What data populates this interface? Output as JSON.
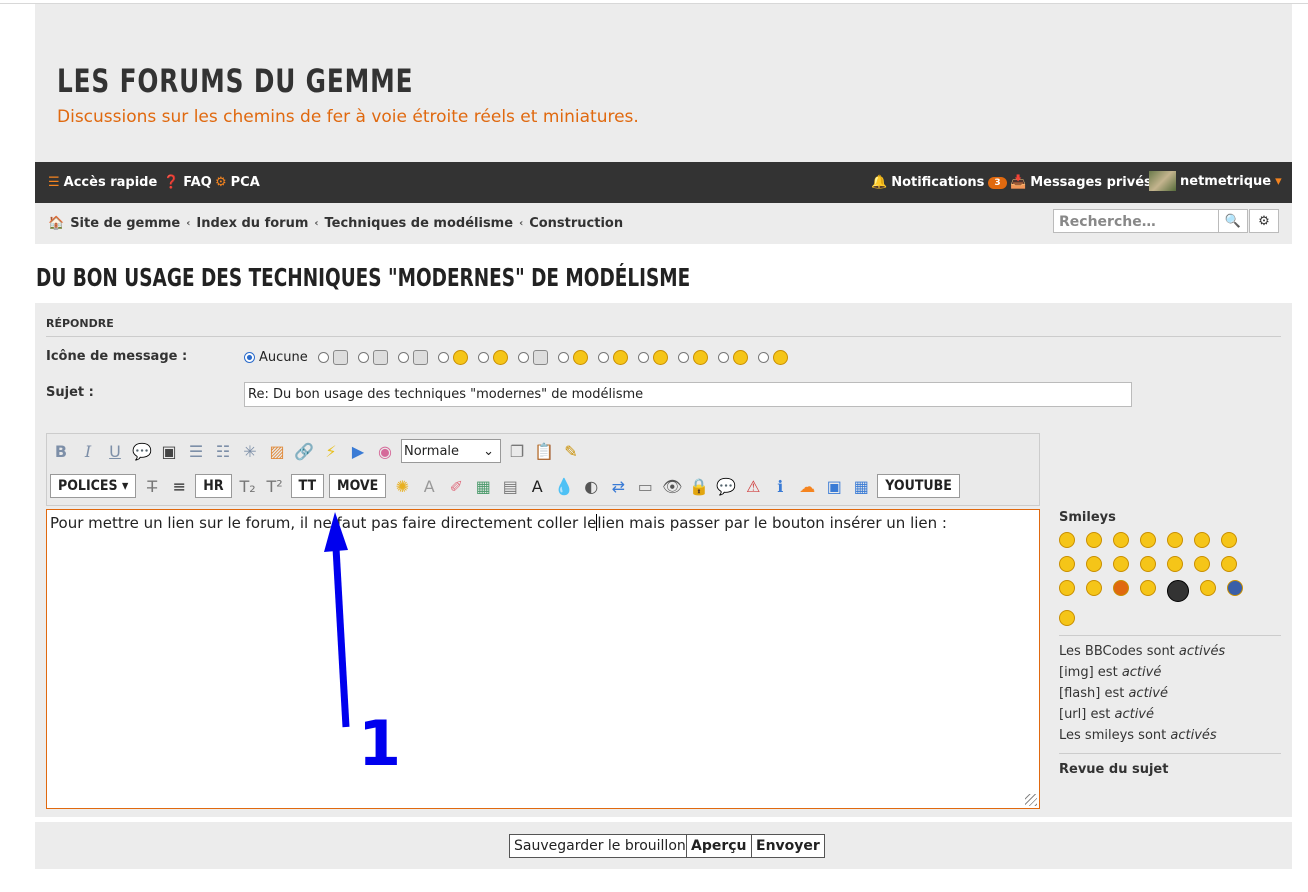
{
  "header": {
    "title": "LES FORUMS DU GEMME",
    "description": "Discussions sur les chemins de fer à voie étroite réels et miniatures."
  },
  "navbar": {
    "quick_access": "Accès rapide",
    "faq": "FAQ",
    "pca": "PCA",
    "notifications": "Notifications",
    "notifications_count": "3",
    "private_messages": "Messages privés",
    "username": "netmetrique"
  },
  "breadcrumbs": [
    "Site de gemme",
    "Index du forum",
    "Techniques de modélisme",
    "Construction"
  ],
  "search": {
    "placeholder": "Recherche…"
  },
  "topic": {
    "title": "DU BON USAGE DES TECHNIQUES \"MODERNES\" DE MODÉLISME"
  },
  "reply": {
    "heading": "RÉPONDRE",
    "icon_label": "Icône de message :",
    "icon_none": "Aucune",
    "subject_label": "Sujet :",
    "subject_value": "Re: Du bon usage des techniques \"modernes\"  de modélisme"
  },
  "toolbar": {
    "font_size_value": "Normale",
    "polices": "POLICES",
    "hr": "HR",
    "tt": "TT",
    "move": "MOVE",
    "youtube": "YOUTUBE"
  },
  "editor": {
    "text_before_caret": "Pour mettre un lien sur le forum, il ne faut pas faire directement coller le",
    "text_after_caret": "lien mais passer par le bouton insérer un lien :"
  },
  "annotation": {
    "label": "1",
    "color": "#0000ee"
  },
  "sidebar": {
    "smileys_title": "Smileys",
    "bbcode_status": "Les BBCodes sont",
    "img_status": "[img] est",
    "flash_status": "[flash] est",
    "url_status": "[url] est",
    "smileys_status": "Les smileys sont",
    "active_plural": "activés",
    "active_singular": "activé",
    "topic_review": "Revue du sujet"
  },
  "buttons": {
    "save_draft": "Sauvegarder le brouillon",
    "preview": "Aperçu",
    "submit": "Envoyer"
  },
  "colors": {
    "accent": "#e0690f",
    "navbar": "#333333",
    "panel": "#ececec"
  }
}
